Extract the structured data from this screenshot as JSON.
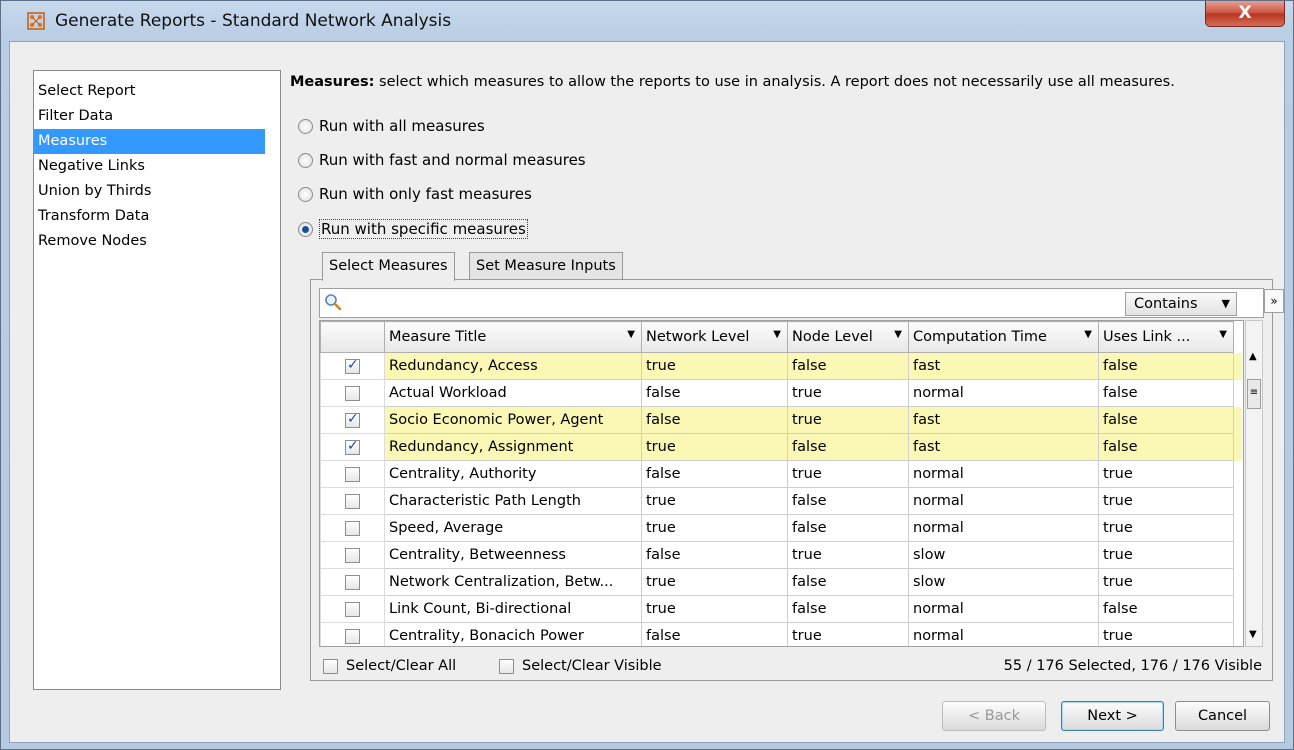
{
  "window": {
    "title": "Generate Reports - Standard Network Analysis",
    "close_label": "X"
  },
  "sidebar": {
    "items": [
      "Select Report",
      "Filter Data",
      "Measures",
      "Negative Links",
      "Union by Thirds",
      "Transform Data",
      "Remove Nodes"
    ],
    "selected": "Measures"
  },
  "description": {
    "bold": "Measures:",
    "text": " select which measures to allow the reports to use in analysis. A report does not necessarily use all measures."
  },
  "options": [
    {
      "label": "Run with all measures",
      "selected": false
    },
    {
      "label": "Run with fast and normal measures",
      "selected": false
    },
    {
      "label": "Run with only fast measures",
      "selected": false
    },
    {
      "label": "Run with specific measures",
      "selected": true
    }
  ],
  "tabs": [
    {
      "label": "Select Measures",
      "active": true
    },
    {
      "label": "Set Measure Inputs",
      "active": false
    }
  ],
  "filter": {
    "search_value": "",
    "mode": "Contains",
    "expand_label": "»"
  },
  "table": {
    "columns": [
      "Measure Title",
      "Network Level",
      "Node Level",
      "Computation Time",
      "Uses Link ..."
    ],
    "rows": [
      {
        "checked": true,
        "cells": [
          "Redundancy, Access",
          "true",
          "false",
          "fast",
          "false"
        ]
      },
      {
        "checked": false,
        "cells": [
          "Actual Workload",
          "false",
          "true",
          "normal",
          "false"
        ]
      },
      {
        "checked": true,
        "cells": [
          "Socio Economic Power, Agent",
          "false",
          "true",
          "fast",
          "false"
        ]
      },
      {
        "checked": true,
        "cells": [
          "Redundancy, Assignment",
          "true",
          "false",
          "fast",
          "false"
        ]
      },
      {
        "checked": false,
        "cells": [
          "Centrality, Authority",
          "false",
          "true",
          "normal",
          "true"
        ]
      },
      {
        "checked": false,
        "cells": [
          "Characteristic Path Length",
          "true",
          "false",
          "normal",
          "true"
        ]
      },
      {
        "checked": false,
        "cells": [
          "Speed, Average",
          "true",
          "false",
          "normal",
          "true"
        ]
      },
      {
        "checked": false,
        "cells": [
          "Centrality, Betweenness",
          "false",
          "true",
          "slow",
          "true"
        ]
      },
      {
        "checked": false,
        "cells": [
          "Network Centralization, Betw...",
          "true",
          "false",
          "slow",
          "true"
        ]
      },
      {
        "checked": false,
        "cells": [
          "Link Count, Bi-directional",
          "true",
          "false",
          "normal",
          "false"
        ]
      },
      {
        "checked": false,
        "cells": [
          "Centrality, Bonacich Power",
          "false",
          "true",
          "normal",
          "true"
        ]
      }
    ]
  },
  "footer": {
    "select_all": "Select/Clear All",
    "select_visible": "Select/Clear Visible",
    "status": "55 / 176 Selected, 176 / 176 Visible"
  },
  "buttons": {
    "back": "< Back",
    "next": "Next >",
    "cancel": "Cancel"
  },
  "colors": {
    "selection": "#3399ff",
    "highlight_row": "#fbf7b4",
    "close_button": "#c9503c"
  }
}
